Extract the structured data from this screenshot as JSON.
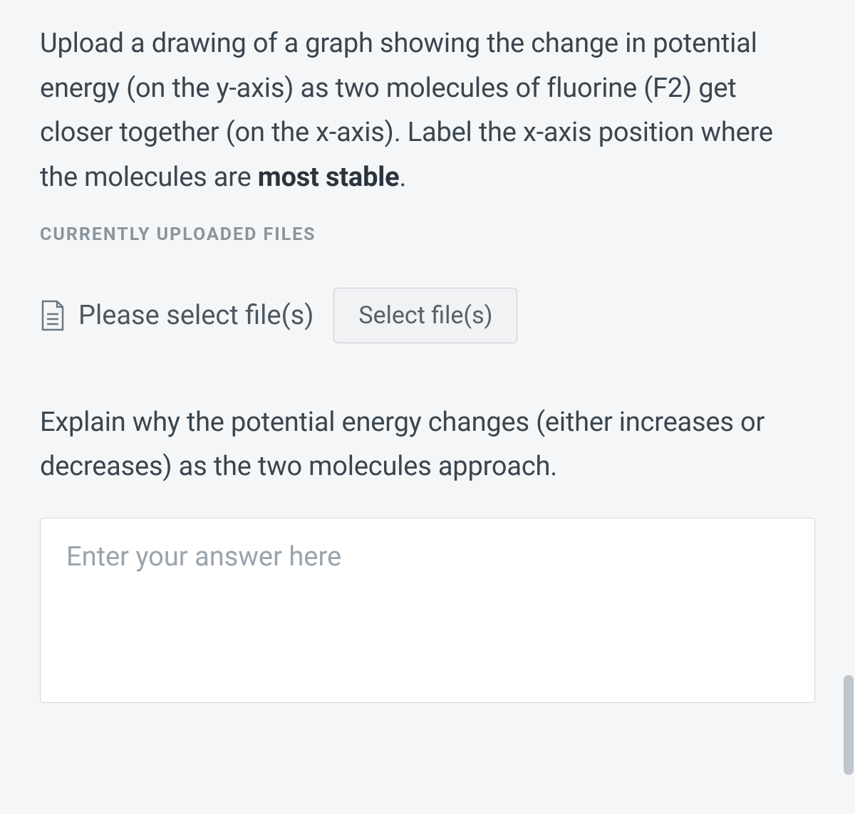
{
  "question1": {
    "prefix": "Upload a drawing of a graph showing the change in potential energy (on the y-axis) as two molecules of fluorine (F2) get closer together (on the x-axis). Label the x-axis position where the molecules are ",
    "bold": "most stable",
    "suffix": "."
  },
  "uploaded_heading": "CURRENTLY UPLOADED FILES",
  "file_picker": {
    "label": "Please select file(s)",
    "button": "Select file(s)"
  },
  "question2": "Explain why the potential energy changes (either increases or decreases) as the two molecules approach.",
  "answer_placeholder": "Enter your answer here"
}
